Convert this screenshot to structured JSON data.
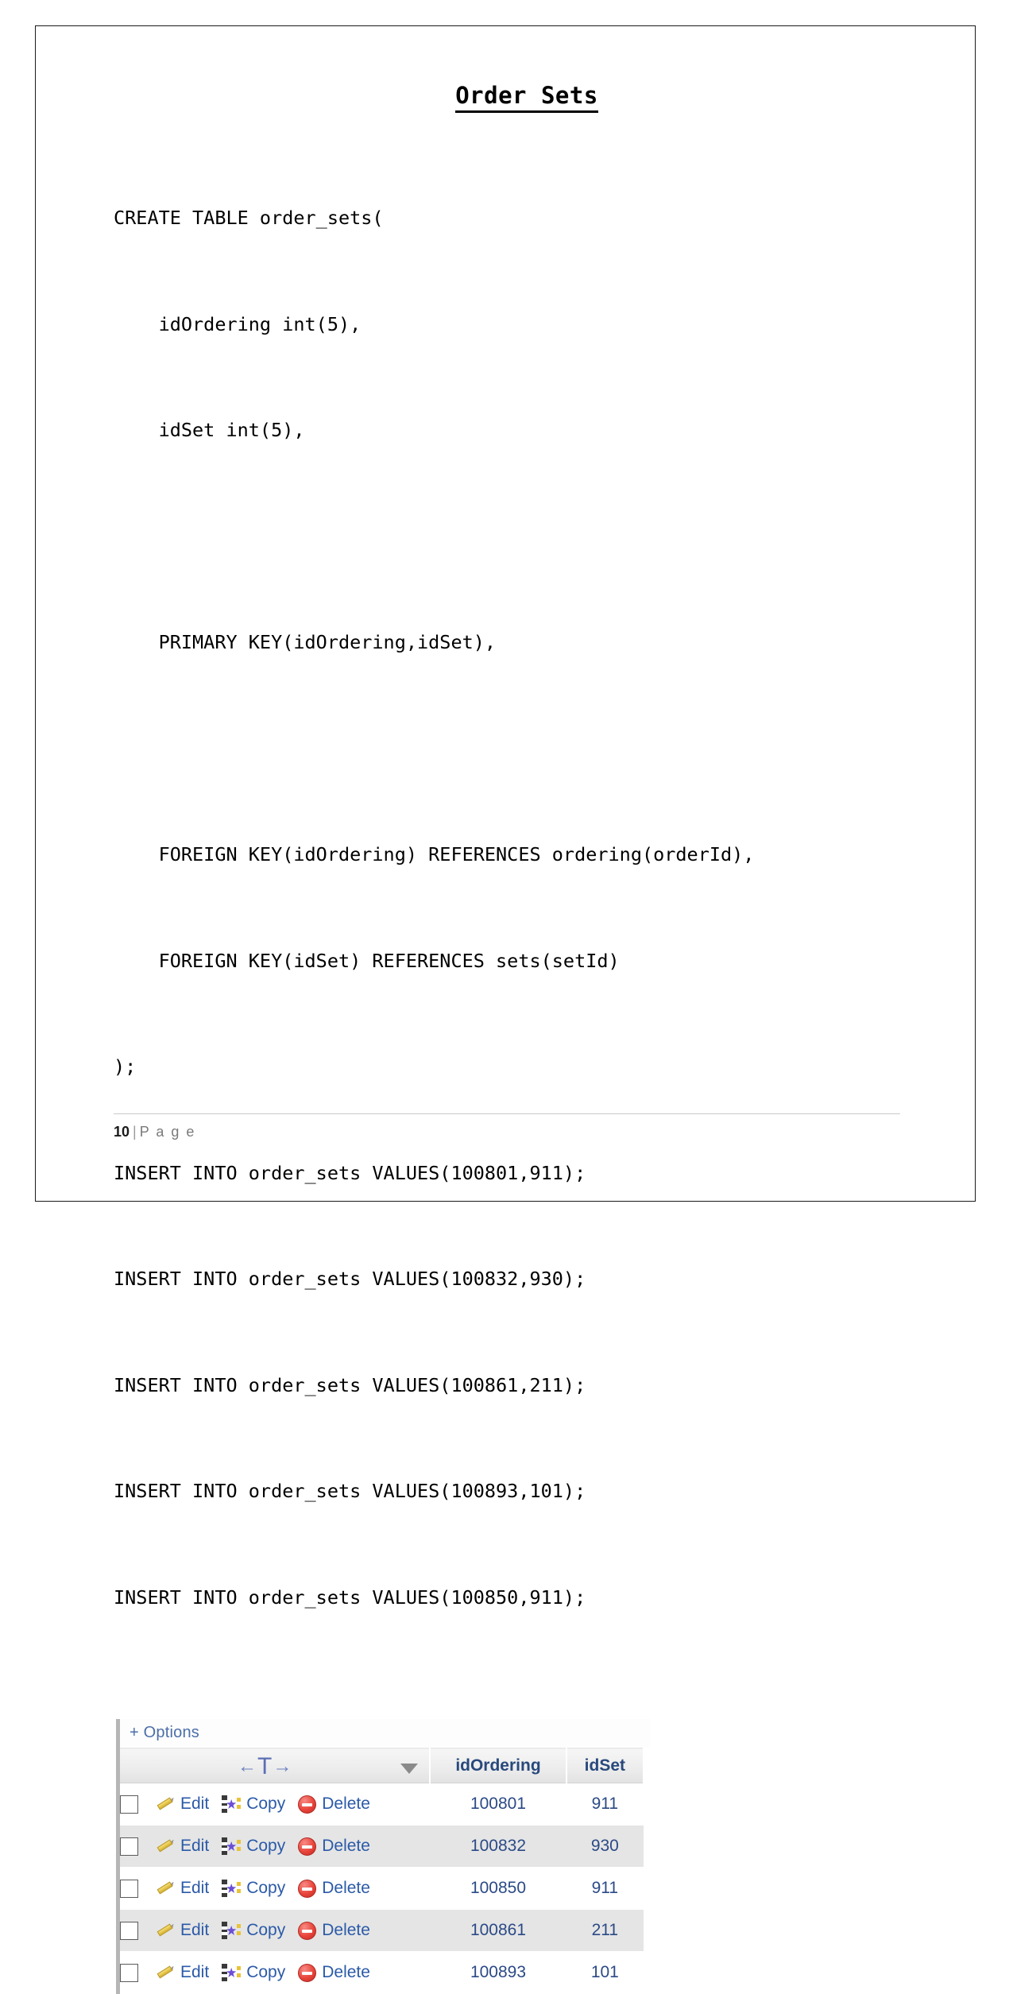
{
  "document": {
    "title": "Order Sets",
    "page_number": "10",
    "footer_separator": "|",
    "footer_label": "P a g e"
  },
  "sql": {
    "lines": [
      "CREATE TABLE order_sets(",
      "    idOrdering int(5),",
      "    idSet int(5),",
      "",
      "    PRIMARY KEY(idOrdering,idSet),",
      "",
      "    FOREIGN KEY(idOrdering) REFERENCES ordering(orderId),",
      "    FOREIGN KEY(idSet) REFERENCES sets(setId)",
      ");",
      "INSERT INTO order_sets VALUES(100801,911);",
      "INSERT INTO order_sets VALUES(100832,930);",
      "INSERT INTO order_sets VALUES(100861,211);",
      "INSERT INTO order_sets VALUES(100893,101);",
      "INSERT INTO order_sets VALUES(100850,911);"
    ]
  },
  "phpmyadmin": {
    "options_label": "+ Options",
    "nav_arrows": {
      "left": "←",
      "center": "T",
      "right": "→"
    },
    "columns": {
      "actions": "",
      "ordering": "idOrdering",
      "set": "idSet"
    },
    "action_labels": {
      "edit": "Edit",
      "copy": "Copy",
      "delete": "Delete"
    },
    "rows": [
      {
        "idOrdering": "100801",
        "idSet": "911"
      },
      {
        "idOrdering": "100832",
        "idSet": "930"
      },
      {
        "idOrdering": "100850",
        "idSet": "911"
      },
      {
        "idOrdering": "100861",
        "idSet": "211"
      },
      {
        "idOrdering": "100893",
        "idSet": "101"
      }
    ],
    "colors": {
      "link_blue": "#2b5aa8",
      "header_blue": "#28497c",
      "row_alt_gray": "#e5e5e5",
      "delete_red": "#e8453c",
      "pencil_yellow": "#e9c94e"
    }
  }
}
